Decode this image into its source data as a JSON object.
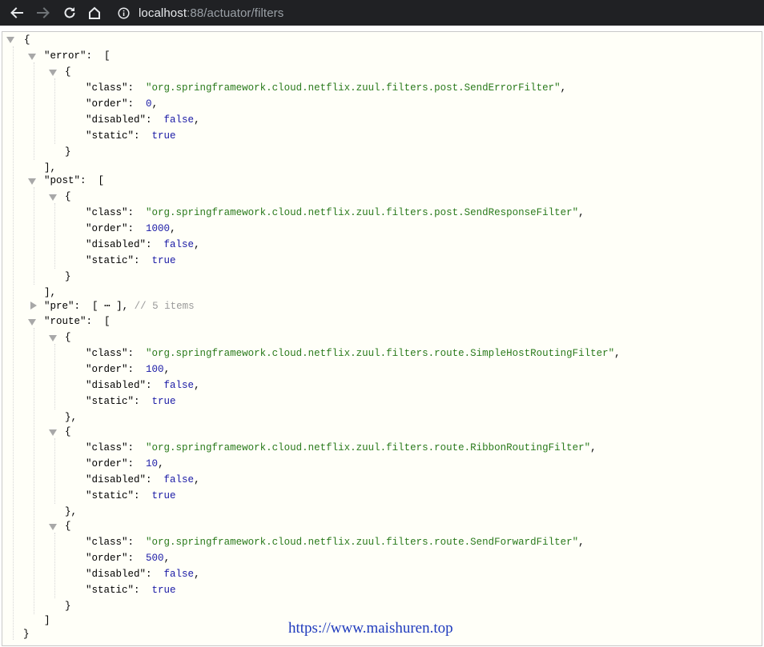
{
  "browser": {
    "url_host": "localhost",
    "url_rest": ":88/actuator/filters",
    "icons": [
      "back-arrow-icon",
      "forward-arrow-icon",
      "reload-icon",
      "home-icon",
      "info-icon"
    ]
  },
  "json": {
    "open_brace": "{",
    "close_brace": "}",
    "open_bracket": "[",
    "close_bracket": "]",
    "close_bracket_comma": "],",
    "close_brace_comma": "},",
    "groups": {
      "error": {
        "key": "\"error\"",
        "items": [
          {
            "class_val": "\"org.springframework.cloud.netflix.zuul.filters.post.SendErrorFilter\"",
            "order_val": "0",
            "disabled_val": "false",
            "static_val": "true"
          }
        ]
      },
      "post": {
        "key": "\"post\"",
        "items": [
          {
            "class_val": "\"org.springframework.cloud.netflix.zuul.filters.post.SendResponseFilter\"",
            "order_val": "1000",
            "disabled_val": "false",
            "static_val": "true"
          }
        ]
      },
      "pre": {
        "key": "\"pre\"",
        "ellipsis": "⋯",
        "comment": "// 5 items"
      },
      "route": {
        "key": "\"route\"",
        "items": [
          {
            "class_val": "\"org.springframework.cloud.netflix.zuul.filters.route.SimpleHostRoutingFilter\"",
            "order_val": "100",
            "disabled_val": "false",
            "static_val": "true"
          },
          {
            "class_val": "\"org.springframework.cloud.netflix.zuul.filters.route.RibbonRoutingFilter\"",
            "order_val": "10",
            "disabled_val": "false",
            "static_val": "true"
          },
          {
            "class_val": "\"org.springframework.cloud.netflix.zuul.filters.route.SendForwardFilter\"",
            "order_val": "500",
            "disabled_val": "false",
            "static_val": "true"
          }
        ]
      }
    },
    "field_keys": {
      "class": "\"class\"",
      "order": "\"order\"",
      "disabled": "\"disabled\"",
      "static": "\"static\""
    },
    "punct": {
      "colon": ":",
      "comma": ","
    }
  },
  "watermark": "https://www.maishuren.top"
}
